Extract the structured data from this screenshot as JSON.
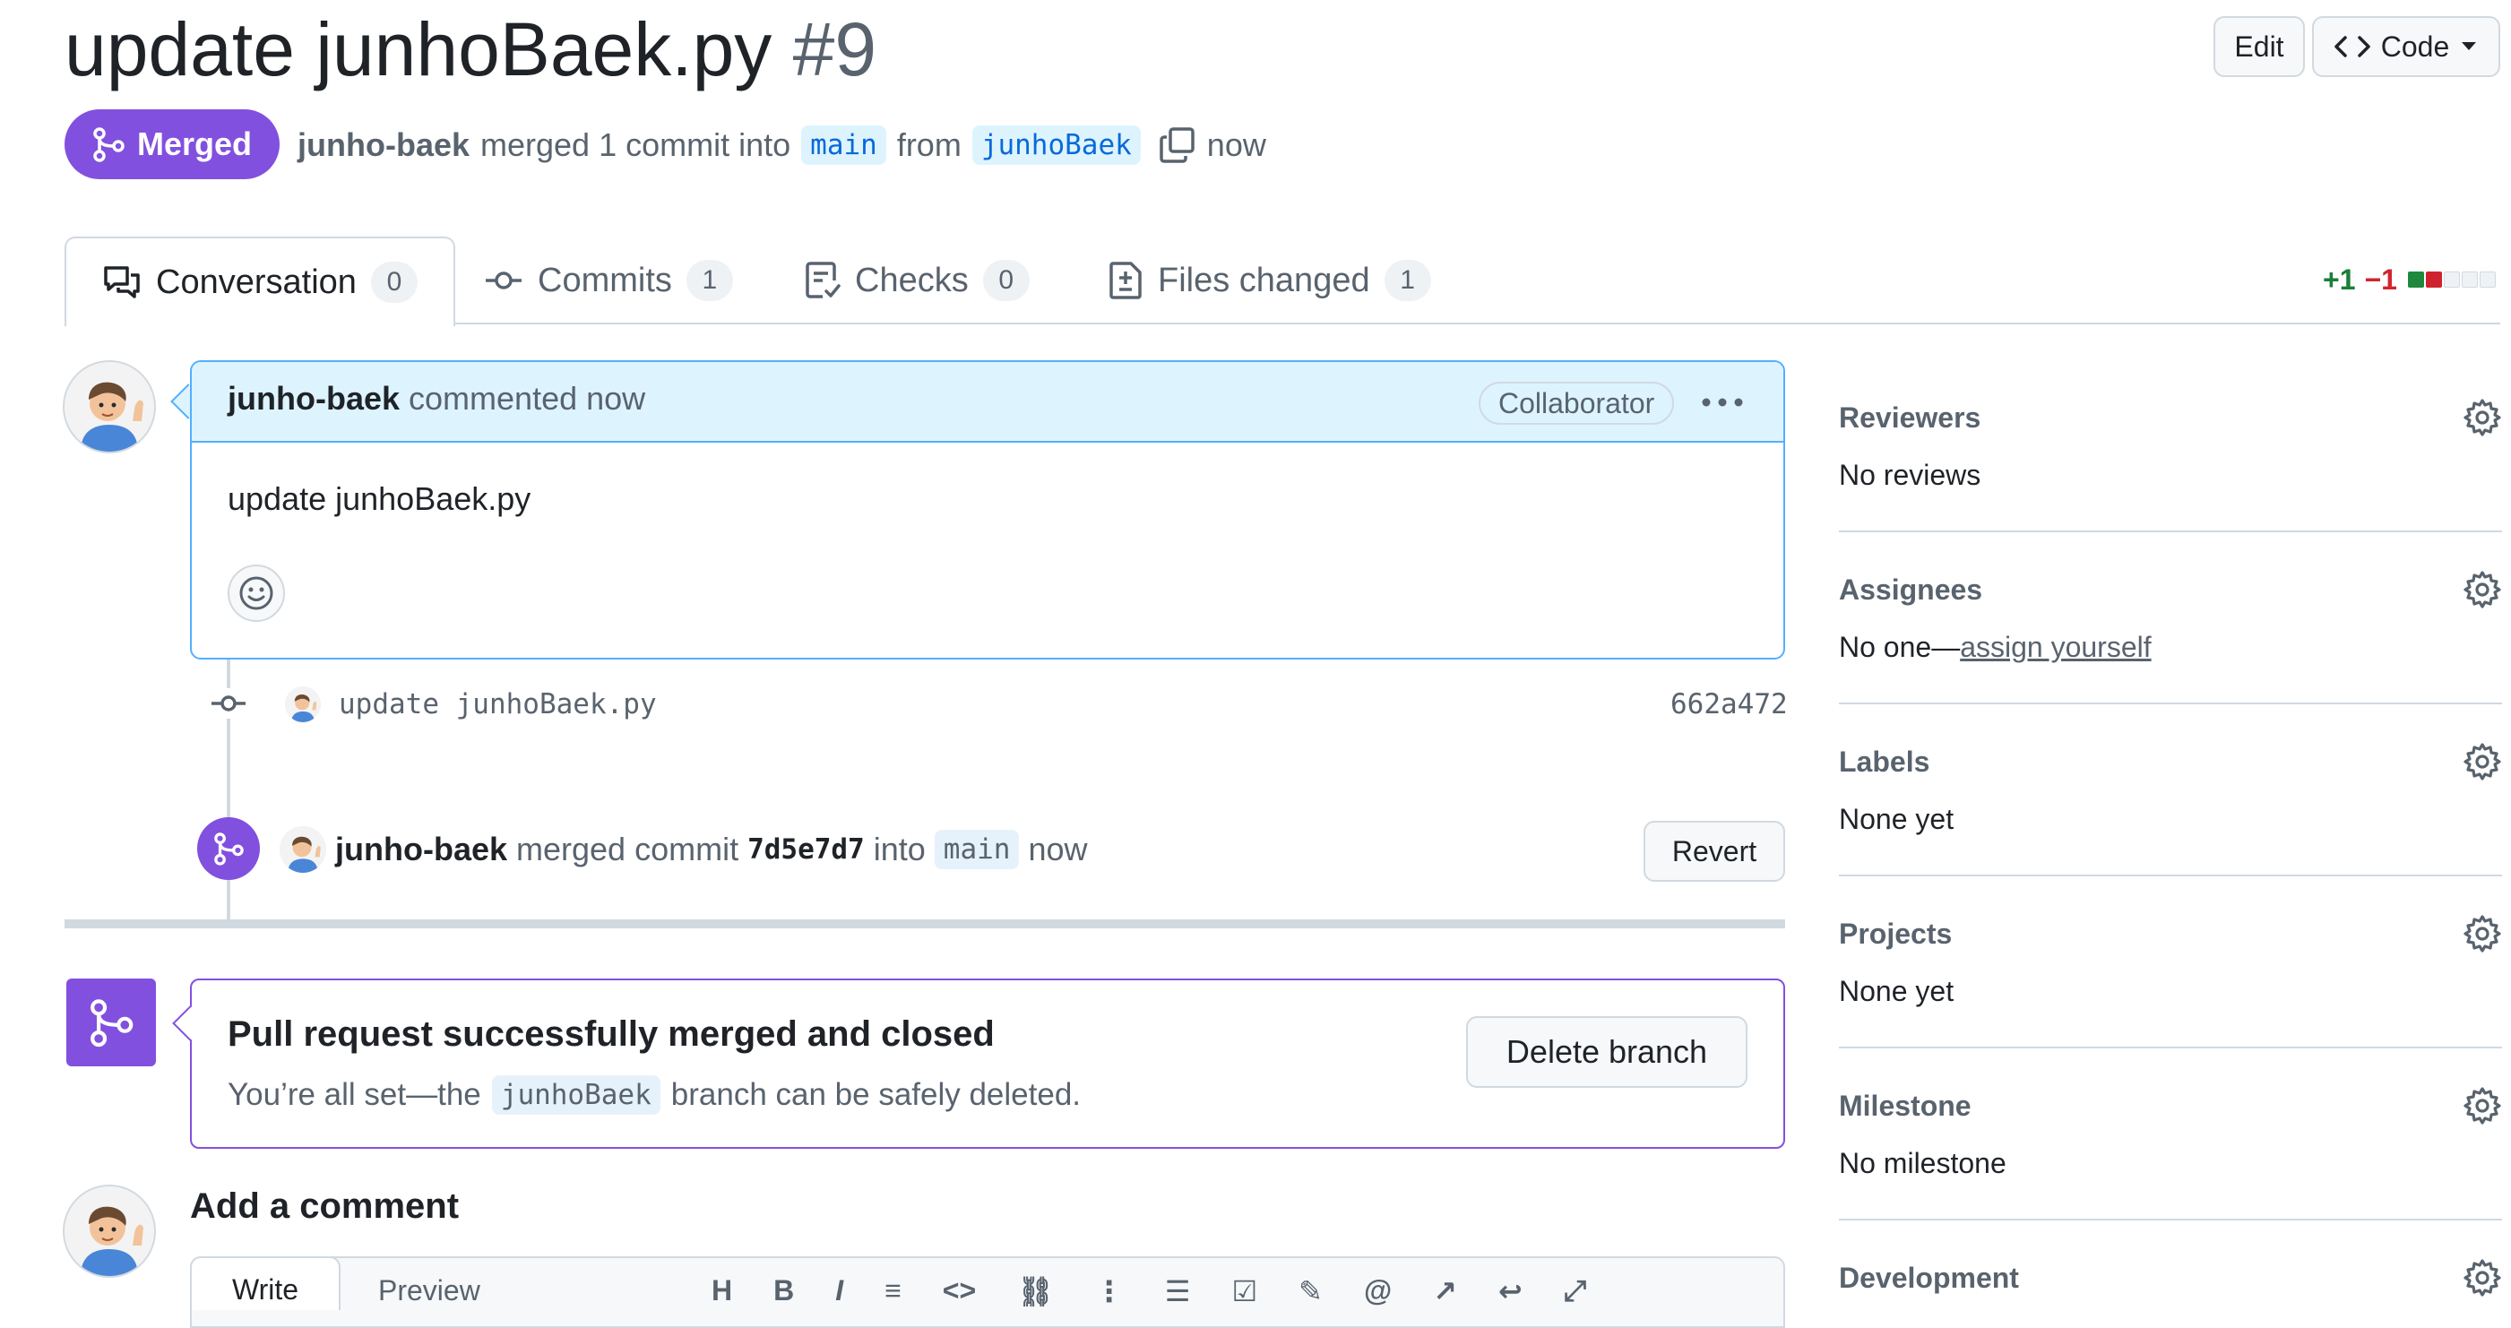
{
  "pr": {
    "title": "update junhoBaek.py",
    "number": "#9",
    "state": "Merged",
    "author": "junho-baek",
    "action": "merged 1 commit into",
    "base_branch": "main",
    "from_word": "from",
    "head_branch": "junhoBaek",
    "time": "now"
  },
  "header_buttons": {
    "edit": "Edit",
    "code": "Code"
  },
  "tabs": [
    {
      "label": "Conversation",
      "count": "0",
      "icon": "comment-discussion-icon"
    },
    {
      "label": "Commits",
      "count": "1",
      "icon": "commit-icon"
    },
    {
      "label": "Checks",
      "count": "0",
      "icon": "checklist-icon"
    },
    {
      "label": "Files changed",
      "count": "1",
      "icon": "file-diff-icon"
    }
  ],
  "diffstat": {
    "additions": "+1",
    "deletions": "−1"
  },
  "comment": {
    "author": "junho-baek",
    "meta": "commented now",
    "role": "Collaborator",
    "body": "update junhoBaek.py"
  },
  "commit_event": {
    "message": "update junhoBaek.py",
    "sha": "662a472"
  },
  "merge_event": {
    "author": "junho-baek",
    "text1": "merged commit",
    "sha": "7d5e7d7",
    "text2": "into",
    "branch": "main",
    "time": "now",
    "revert": "Revert"
  },
  "merged_box": {
    "title": "Pull request successfully merged and closed",
    "text_before": "You’re all set—the",
    "branch": "junhoBaek",
    "text_after": "branch can be safely deleted.",
    "button": "Delete branch"
  },
  "add_comment": {
    "heading": "Add a comment",
    "write": "Write",
    "preview": "Preview"
  },
  "sidebar": {
    "reviewers": {
      "title": "Reviewers",
      "value": "No reviews"
    },
    "assignees": {
      "title": "Assignees",
      "prefix": "No one—",
      "link": "assign yourself"
    },
    "labels": {
      "title": "Labels",
      "value": "None yet"
    },
    "projects": {
      "title": "Projects",
      "value": "None yet"
    },
    "milestone": {
      "title": "Milestone",
      "value": "No milestone"
    },
    "development": {
      "title": "Development"
    }
  },
  "colors": {
    "merged": "#8250df",
    "accent": "#0969da",
    "add": "#1a7f37",
    "del": "#d1242f"
  }
}
